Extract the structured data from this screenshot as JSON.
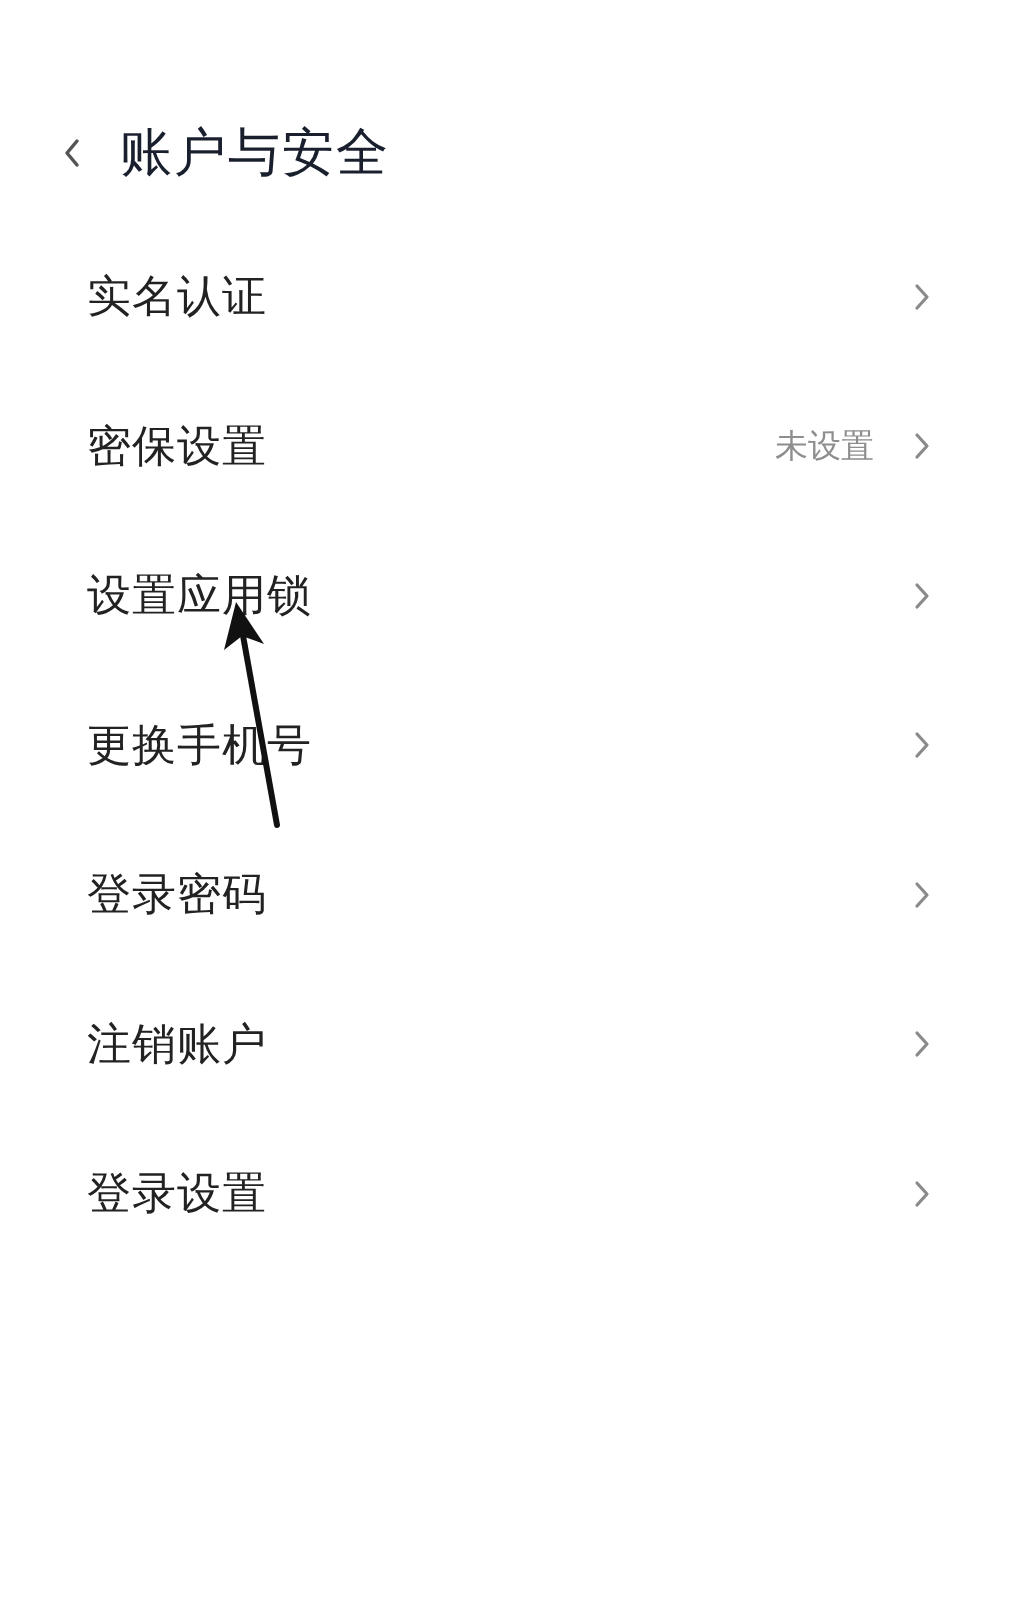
{
  "header": {
    "title": "账户与安全"
  },
  "items": [
    {
      "label": "实名认证"
    },
    {
      "label": "密保设置",
      "value": "未设置"
    },
    {
      "label": "设置应用锁"
    },
    {
      "label": "更换手机号"
    },
    {
      "label": "登录密码"
    },
    {
      "label": "注销账户"
    },
    {
      "label": "登录设置"
    }
  ]
}
